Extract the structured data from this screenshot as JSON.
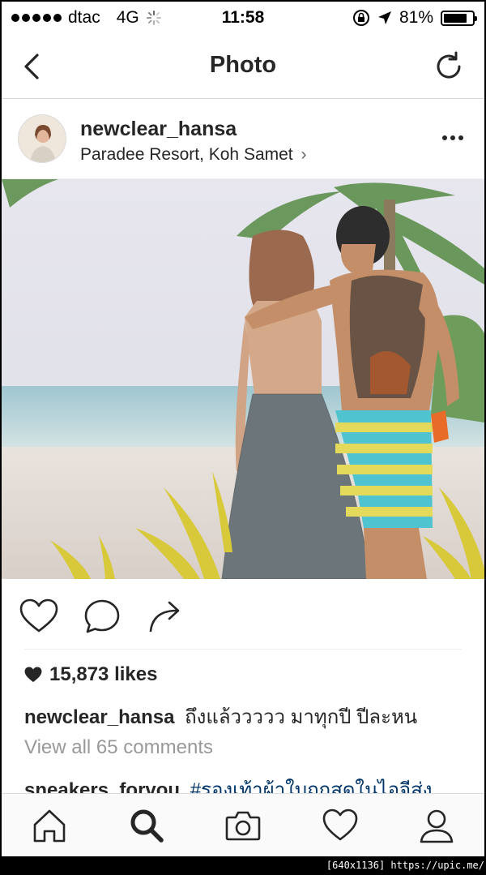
{
  "status_bar": {
    "carrier": "dtac",
    "network": "4G",
    "time": "11:58",
    "battery": "81%",
    "battery_level": 0.81
  },
  "nav": {
    "title": "Photo",
    "back_icon": "chevron-left-icon",
    "refresh_icon": "refresh-icon"
  },
  "post": {
    "username": "newclear_hansa",
    "location": "Paradee Resort, Koh Samet",
    "location_chevron": "›",
    "likes": "15,873 likes",
    "caption_user": "newclear_hansa",
    "caption_text": "ถึงแล้ววววว มาทุกปี ปีละหน",
    "view_all": "View all 65 comments",
    "comment_user": "sneakers_forvou",
    "comment_tag": "#รองเท้าผ้าใบถูกสดในไอจีส่ง"
  },
  "tabs": [
    "home-icon",
    "search-icon",
    "camera-icon",
    "heart-icon",
    "profile-icon"
  ],
  "watermark": "[640x1136] https://upic.me/",
  "colors": {
    "text": "#262626",
    "muted": "#999999",
    "hashtag": "#003569",
    "tabbar_bg": "#fafafa"
  }
}
